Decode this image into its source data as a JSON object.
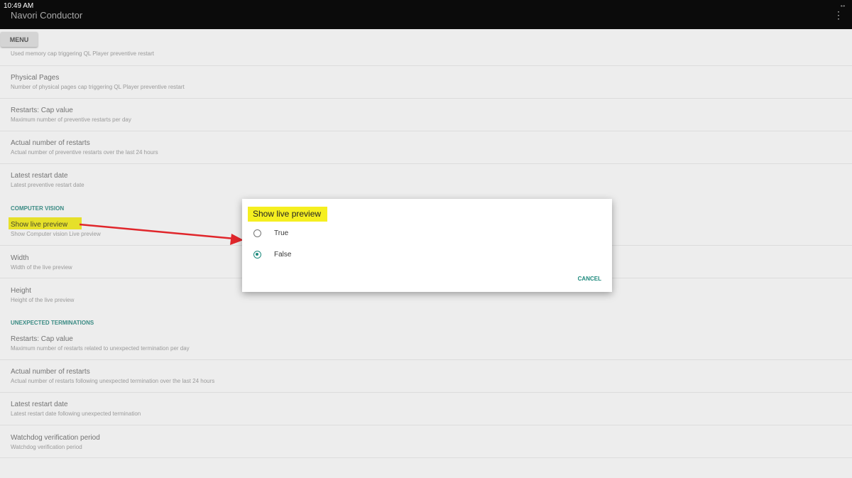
{
  "status_bar": {
    "time": "10:49 AM"
  },
  "app_bar": {
    "title": "Navori Conductor",
    "overflow_icon": "more-vert-icon",
    "expand_icon": "expand-arrows-icon"
  },
  "menu_button": {
    "label": "MENU"
  },
  "settings": {
    "first_subtitle": "Used memory cap triggering QL Player preventive restart",
    "items": [
      {
        "title": "Physical Pages",
        "subtitle": "Number of physical pages cap triggering QL Player preventive restart"
      },
      {
        "title": "Restarts: Cap value",
        "subtitle": "Maximum number of preventive restarts per day"
      },
      {
        "title": "Actual number of restarts",
        "subtitle": "Actual number of preventive restarts over the last 24 hours"
      },
      {
        "title": "Latest restart date",
        "subtitle": "Latest preventive restart date"
      }
    ],
    "section_cv": "COMPUTER VISION",
    "cv_items": [
      {
        "title": "Show live preview",
        "subtitle": "Show Computer vision Live preview"
      },
      {
        "title": "Width",
        "subtitle": "Width of the live preview"
      },
      {
        "title": "Height",
        "subtitle": "Height of the live preview"
      }
    ],
    "section_ut": "UNEXPECTED TERMINATIONS",
    "ut_items": [
      {
        "title": "Restarts: Cap value",
        "subtitle": "Maximum number of restarts related to unexpected termination per day"
      },
      {
        "title": "Actual number of restarts",
        "subtitle": "Actual number of restarts following unexpected termination over the last 24 hours"
      },
      {
        "title": "Latest restart date",
        "subtitle": "Latest restart date following unexpected termination"
      },
      {
        "title": "Watchdog verification period",
        "subtitle": "Watchdog verification period"
      }
    ]
  },
  "dialog": {
    "title": "Show live preview",
    "options": [
      {
        "label": "True",
        "selected": false
      },
      {
        "label": "False",
        "selected": true
      }
    ],
    "cancel_label": "CANCEL"
  },
  "colors": {
    "accent": "#1d8a7d",
    "highlight": "#f5ef20",
    "arrow": "#e0262b",
    "topbar": "#0b0b0b"
  }
}
